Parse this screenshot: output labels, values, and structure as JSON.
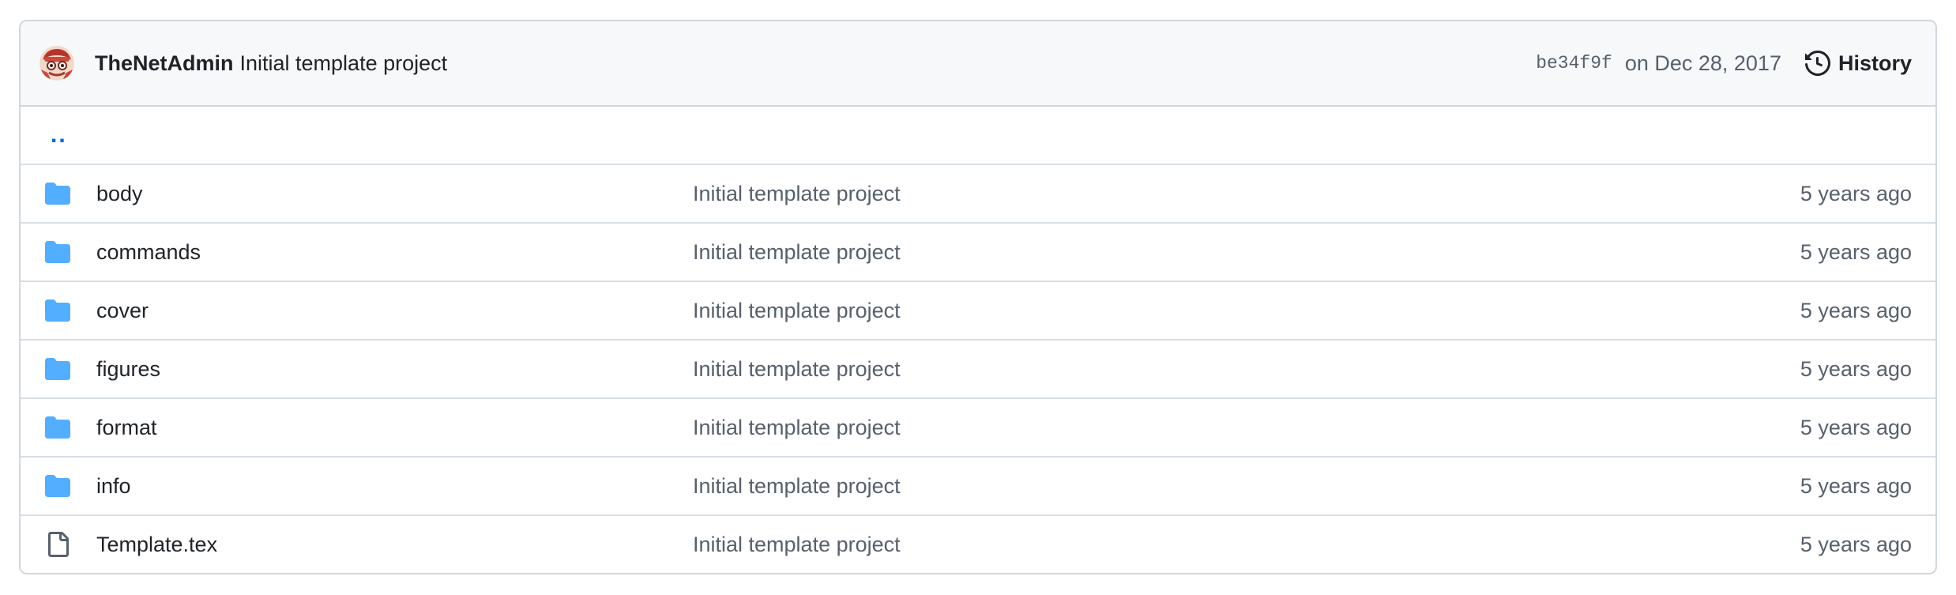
{
  "latest_commit": {
    "author": "TheNetAdmin",
    "message": "Initial template project",
    "sha": "be34f9f",
    "date": "on Dec 28, 2017",
    "history_label": "History"
  },
  "parent_link": "..",
  "files": [
    {
      "type": "folder",
      "icon": "folder-icon",
      "name": "body",
      "message": "Initial template project",
      "age": "5 years ago"
    },
    {
      "type": "folder",
      "icon": "folder-icon",
      "name": "commands",
      "message": "Initial template project",
      "age": "5 years ago"
    },
    {
      "type": "folder",
      "icon": "folder-icon",
      "name": "cover",
      "message": "Initial template project",
      "age": "5 years ago"
    },
    {
      "type": "folder",
      "icon": "folder-icon",
      "name": "figures",
      "message": "Initial template project",
      "age": "5 years ago"
    },
    {
      "type": "folder",
      "icon": "folder-icon",
      "name": "format",
      "message": "Initial template project",
      "age": "5 years ago"
    },
    {
      "type": "folder",
      "icon": "folder-icon",
      "name": "info",
      "message": "Initial template project",
      "age": "5 years ago"
    },
    {
      "type": "file",
      "icon": "file-icon",
      "name": "Template.tex",
      "message": "Initial template project",
      "age": "5 years ago"
    }
  ],
  "colors": {
    "folder": "#54aeff",
    "link": "#0969da",
    "muted": "#57606a",
    "header_bg": "#f6f8fa",
    "border": "#d0d7de"
  }
}
